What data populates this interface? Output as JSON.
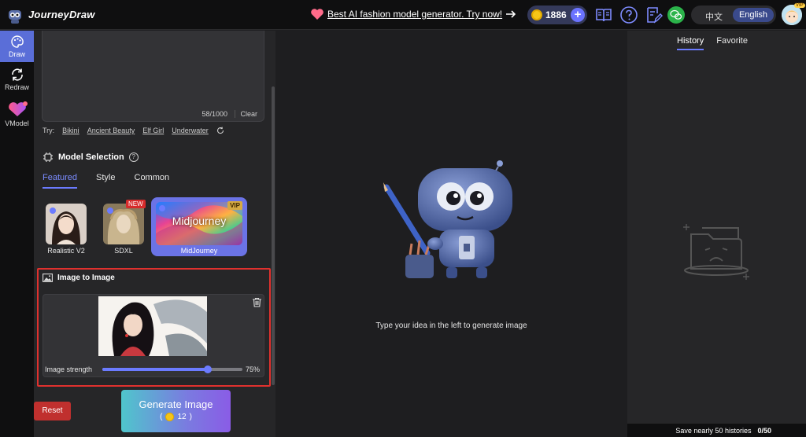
{
  "header": {
    "app_title": "JourneyDraw",
    "promo_text": "Best AI fashion model generator. Try now!",
    "coin_balance": "1886",
    "lang_zh": "中文",
    "lang_en": "English",
    "avatar_badge": "VIP"
  },
  "rail": {
    "items": [
      {
        "label": "Draw",
        "icon": "palette-icon",
        "active": true
      },
      {
        "label": "Redraw",
        "icon": "redraw-icon",
        "active": false
      },
      {
        "label": "VModel",
        "icon": "vmodel-heart-icon",
        "active": false
      }
    ]
  },
  "prompt": {
    "char_count": "58/1000",
    "clear_label": "Clear",
    "try_label": "Try:",
    "suggestions": [
      "Bikini",
      "Ancient Beauty",
      "Elf Girl",
      "Underwater"
    ]
  },
  "models": {
    "title": "Model Selection",
    "tabs": [
      "Featured",
      "Style",
      "Common"
    ],
    "cards": [
      {
        "name": "Realistic V2"
      },
      {
        "name": "SDXL",
        "badge": "NEW"
      },
      {
        "name": "MidJourney",
        "badge": "VIP",
        "wordmark": "Midjourney",
        "selected": true
      }
    ]
  },
  "image_to_image": {
    "title": "Image to Image",
    "strength_label": "Image strength",
    "strength_value": "75%",
    "strength_fraction": 0.75
  },
  "actions": {
    "reset_label": "Reset",
    "generate_label": "Generate Image",
    "generate_cost": "12"
  },
  "canvas": {
    "hint": "Type your idea in the left to generate image"
  },
  "history": {
    "tabs": [
      "History",
      "Favorite"
    ],
    "footer_text": "Save nearly 50 histories",
    "footer_count": "0/50"
  },
  "colors": {
    "accent": "#6b7bff",
    "danger": "#c0302e",
    "coin": "#f5c518"
  }
}
